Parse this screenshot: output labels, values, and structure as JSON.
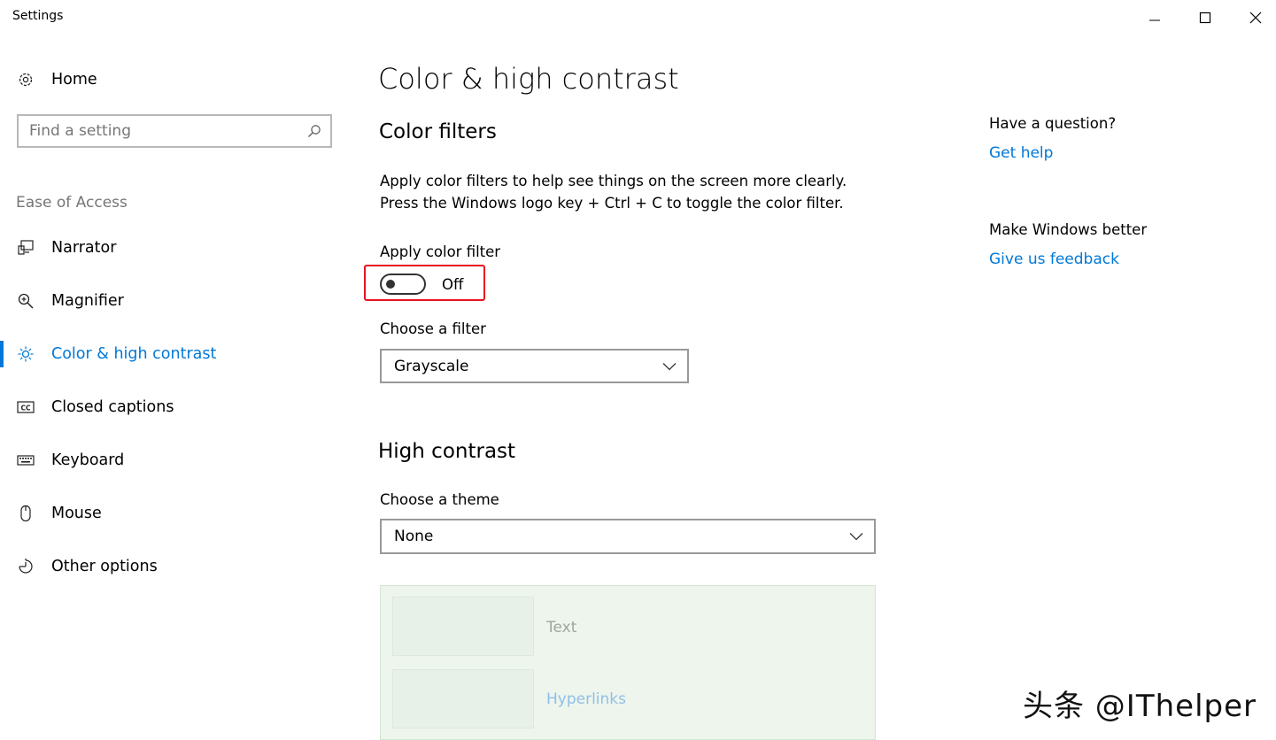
{
  "window": {
    "title": "Settings"
  },
  "sidebar": {
    "home_label": "Home",
    "search": {
      "placeholder": "Find a setting"
    },
    "category": "Ease of Access",
    "items": [
      {
        "label": "Narrator",
        "icon": "narrator-icon",
        "active": false
      },
      {
        "label": "Magnifier",
        "icon": "magnifier-icon",
        "active": false
      },
      {
        "label": "Color & high contrast",
        "icon": "brightness-icon",
        "active": true
      },
      {
        "label": "Closed captions",
        "icon": "cc-icon",
        "active": false
      },
      {
        "label": "Keyboard",
        "icon": "keyboard-icon",
        "active": false
      },
      {
        "label": "Mouse",
        "icon": "mouse-icon",
        "active": false
      },
      {
        "label": "Other options",
        "icon": "timer-icon",
        "active": false
      }
    ]
  },
  "main": {
    "title": "Color & high contrast",
    "color_filters": {
      "heading": "Color filters",
      "description_line1": "Apply color filters to help see things on the screen more clearly.",
      "description_line2": "Press the Windows logo key + Ctrl + C to toggle the color filter.",
      "toggle_label": "Apply color filter",
      "toggle_state": "Off",
      "filter_label": "Choose a filter",
      "filter_value": "Grayscale"
    },
    "high_contrast": {
      "heading": "High contrast",
      "theme_label": "Choose a theme",
      "theme_value": "None",
      "preview": {
        "text_label": "Text",
        "hyperlinks_label": "Hyperlinks"
      }
    }
  },
  "right_panel": {
    "question_heading": "Have a question?",
    "get_help": "Get help",
    "feedback_heading": "Make Windows better",
    "give_feedback": "Give us feedback"
  },
  "watermark": "头条 @IThelper",
  "colors": {
    "accent": "#0078d7",
    "highlight": "#e81123",
    "preview_bg": "#edf5ec"
  }
}
